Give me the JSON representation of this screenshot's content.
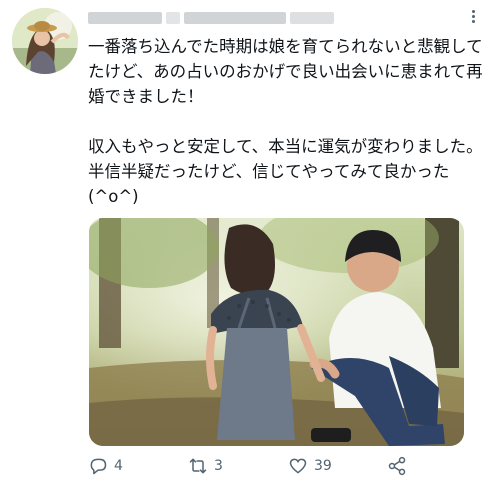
{
  "tweet": {
    "text": "一番落ち込んでた時期は娘を育てられないと悲観してたけど、あの占いのおかげで良い出会いに恵まれて再婚できました！\n\n収入もやっと安定して、本当に運気が変わりました。半信半疑だったけど、信じてやってみて良かった(^o^)"
  },
  "actions": {
    "reply_count": "4",
    "retweet_count": "3",
    "like_count": "39"
  },
  "icons": {
    "reply": "reply-icon",
    "retweet": "retweet-icon",
    "like": "heart-icon",
    "share": "share-icon",
    "more": "more-options-icon"
  },
  "colors": {
    "text": "#0f1419",
    "secondary": "#536471"
  }
}
